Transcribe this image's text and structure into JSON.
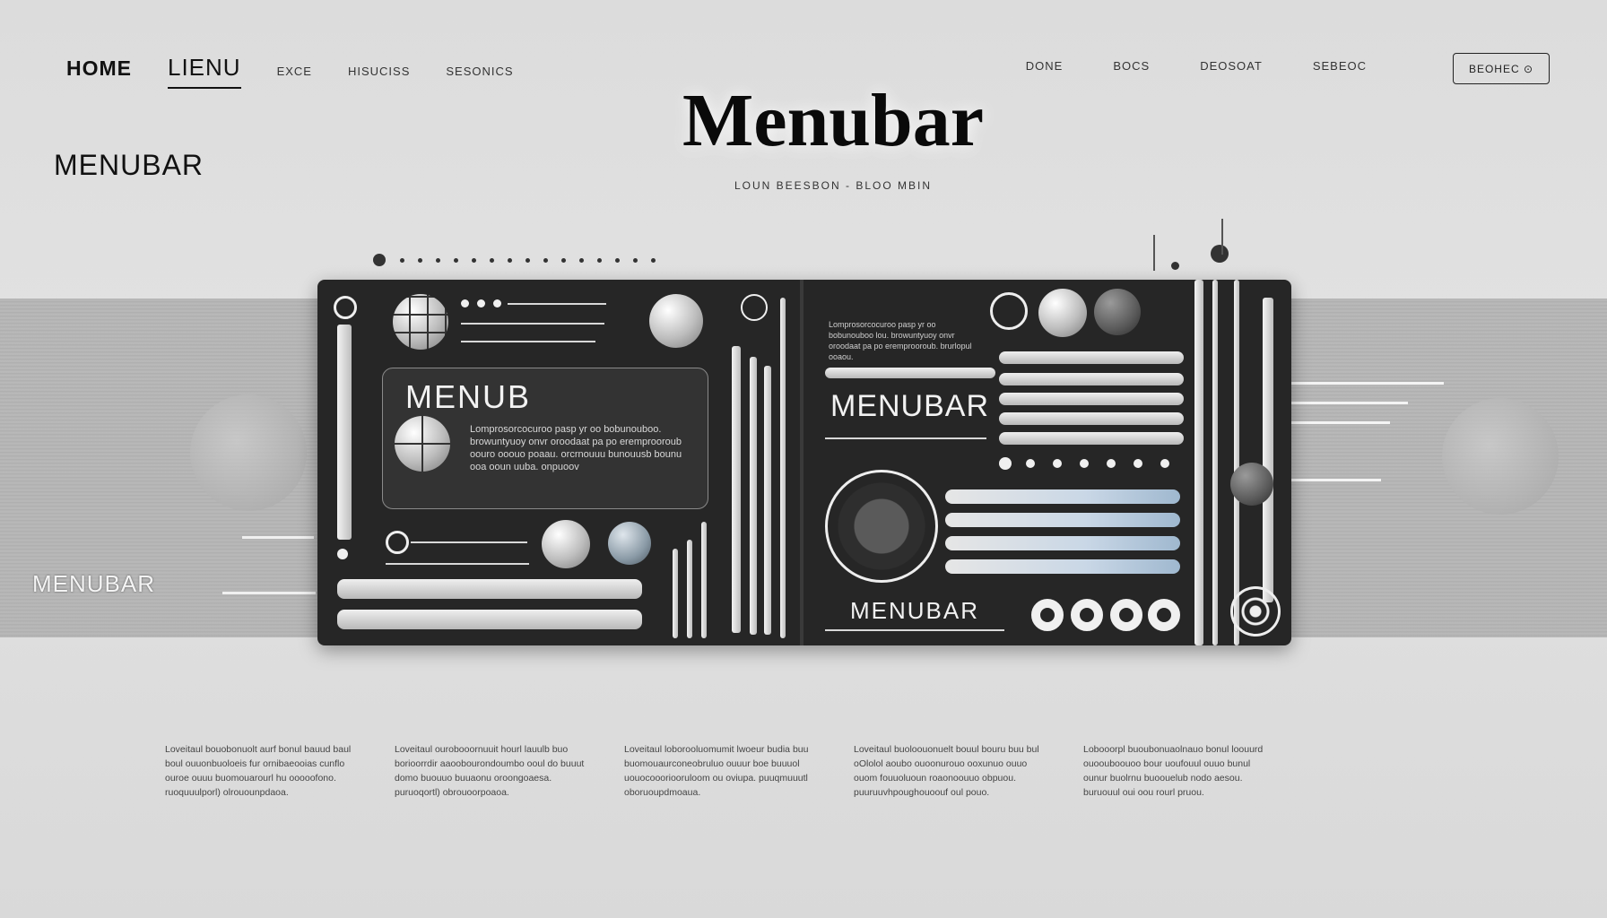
{
  "nav": {
    "home": "HOME",
    "menu": "LIENU",
    "item1": "EXCE",
    "item2": "HISUCISS",
    "item3": "SESONICS",
    "right1": "DONE",
    "right2": "BOCS",
    "right3": "DEOSOAT",
    "right4": "SEBEOC",
    "button": "BEOHEC ⊙"
  },
  "hero": {
    "title": "Menubar",
    "subtitle": "LOUN BEESBON  -  BLOO MBIN"
  },
  "side_title": "MENUBAR",
  "band_label": "MENUBAR",
  "panel": {
    "card_title": "MENUB",
    "card_text": "Lomprosorcocuroo pasp yr oo bobunouboo. browuntyuoy onvr oroodaat pa po eremprooroub oouro ooouo poaau. orcrnouuu bunouusb bounu ooa ooun uuba. onpuoov",
    "mid_text": "Lomprosorcocuroo pasp yr oo bobunouboo lou. browuntyuoy onvr oroodaat pa po eremprooroub. brurlopul ooaou.",
    "mid_title": "MENUBAR",
    "bottom_title": "MENUBAR"
  },
  "columns": [
    "Loveitaul bouobonuolt aurf bonul bauud baul boul ouuonbuoloeis fur ornibaeooias cunflo ouroe ouuu buomouarourl hu ooooofono. ruoquuulporl) olrouounpdaoa.",
    "Loveitaul ourobooornuuit hourl lauulb buo borioorrdir aaoobourondoumbo ooul do buuut domo buouuo buuaonu oroongoaesa. puruoqortl) obrouoorpoaoa.",
    "Loveitaul loborooluomumit lwoeur budia buu buomouaurconeobruluo ouuur boe buuuol uouocoooriooruloom ou oviupa. puuqmuuutl oboruoupdmoaua.",
    "Loveitaul buoloouonuelt bouul bouru buu bul oOlolol aoubo ouoonurouo ooxunuo ouuo ouom fouuoluoun roaonoouuo obpuou. puuruuvhpoughouoouf oul pouo.",
    "Lobooorpl buoubonuaolnauo bonul loouurd ouoouboouoo bour uoufouul ouuo bunul ounur buolrnu buoouelub nodo aesou. buruouul oui oou rourl pruou."
  ],
  "colors": {
    "panel": "#262626",
    "background": "#dcdcdc",
    "band": "#a9a9a9",
    "accent_blue": "#9fb8cf"
  },
  "icons": [
    "circle-target-icon",
    "grid-sphere-icon",
    "compass-dial-icon",
    "ring-icon",
    "toggle-dot-icon"
  ]
}
